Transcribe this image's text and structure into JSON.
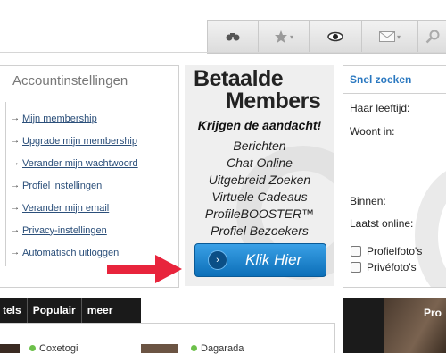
{
  "toolbar": {
    "buttons": [
      {
        "icon": "binoculars-icon"
      },
      {
        "icon": "star-icon",
        "has_dropdown": true
      },
      {
        "icon": "eye-icon"
      },
      {
        "icon": "envelope-icon",
        "has_dropdown": true
      },
      {
        "icon": "search-icon"
      }
    ]
  },
  "account": {
    "title": "Accountinstellingen",
    "links": [
      "Mijn membership",
      "Upgrade mijn membership",
      "Verander mijn wachtwoord",
      "Profiel instellingen",
      "Verander mijn email",
      "Privacy-instellingen",
      "Automatisch uitloggen"
    ]
  },
  "promo": {
    "headline1": "Betaalde",
    "headline2": "Members",
    "tagline": "Krijgen de aandacht!",
    "features": [
      "Berichten",
      "Chat Online",
      "Uitgebreid Zoeken",
      "Virtuele Cadeaus",
      "ProfileBOOSTER™",
      "Profiel Bezoekers"
    ],
    "button_label": "Klik Hier"
  },
  "search": {
    "title": "Snel zoeken",
    "age_label": "Haar leeftijd:",
    "location_label": "Woont in:",
    "since_label": "Binnen:",
    "last_online_label": "Laatst online:",
    "checkbox_photos": "Profielfoto's",
    "checkbox_private": "Privéfoto's"
  },
  "tabs": [
    "tels",
    "Populair",
    "meer"
  ],
  "members": [
    {
      "name": "Coxetogi"
    },
    {
      "name": "Dagarada"
    }
  ],
  "bottom_right_text": "Pro",
  "colors": {
    "link": "#2b4f7a",
    "search_title": "#2a78c0",
    "button": "#1a84d0",
    "arrow": "#e8243c",
    "online": "#6cc04a"
  }
}
